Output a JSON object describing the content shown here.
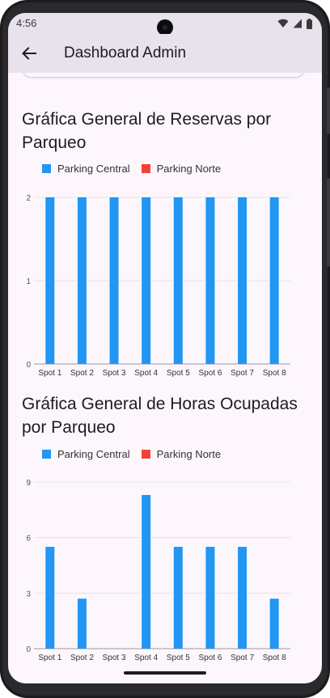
{
  "status_bar": {
    "time": "4:56",
    "icons": [
      "wifi-icon",
      "signal-icon",
      "battery-icon"
    ]
  },
  "app_bar": {
    "title": "Dashboard Admin",
    "back_icon": "arrow-back-icon"
  },
  "colors": {
    "series1": "#2196f3",
    "series2": "#f44336",
    "app_bar_bg": "#e8e2ec",
    "screen_bg": "#fdf7fd"
  },
  "charts": {
    "reservas": {
      "title": "Gráfica General de Reservas por Parqueo",
      "legend": [
        "Parking Central",
        "Parking Norte"
      ]
    },
    "horas": {
      "title": "Gráfica General de Horas Ocupadas por Parqueo",
      "legend": [
        "Parking Central",
        "Parking Norte"
      ]
    }
  },
  "chart_data": [
    {
      "type": "bar",
      "title": "Gráfica General de Reservas por Parqueo",
      "categories": [
        "Spot 1",
        "Spot 2",
        "Spot 3",
        "Spot 4",
        "Spot 5",
        "Spot 6",
        "Spot 7",
        "Spot 8"
      ],
      "series": [
        {
          "name": "Parking Central",
          "values": [
            2,
            2,
            2,
            2,
            2,
            2,
            2,
            2
          ]
        },
        {
          "name": "Parking Norte",
          "values": [
            0,
            0,
            0,
            0,
            0,
            0,
            0,
            0
          ]
        }
      ],
      "yticks": [
        0,
        1,
        2
      ],
      "ylim": [
        0,
        2
      ],
      "grid": true,
      "legend_position": "top-left"
    },
    {
      "type": "bar",
      "title": "Gráfica General de Horas Ocupadas por Parqueo",
      "categories": [
        "Spot 1",
        "Spot 2",
        "Spot 3",
        "Spot 4",
        "Spot 5",
        "Spot 6",
        "Spot 7",
        "Spot 8"
      ],
      "series": [
        {
          "name": "Parking Central",
          "values": [
            5.5,
            2.7,
            0,
            8.3,
            5.5,
            5.5,
            5.5,
            2.7
          ]
        },
        {
          "name": "Parking Norte",
          "values": [
            0,
            0,
            0,
            0,
            0,
            0,
            0,
            0
          ]
        }
      ],
      "yticks": [
        0,
        3,
        6,
        9
      ],
      "ylim": [
        0,
        9
      ],
      "grid": true,
      "legend_position": "top-left"
    }
  ]
}
